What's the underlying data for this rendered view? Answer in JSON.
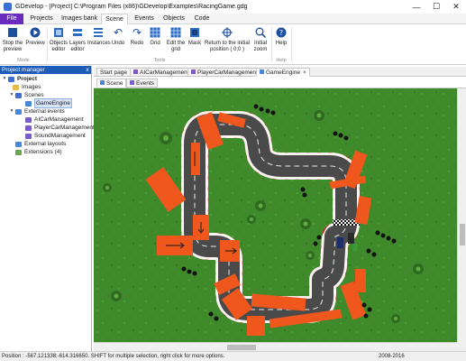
{
  "window": {
    "title": "GDevelop - [Project] C:\\Program Files (x86)\\GDevelop\\Examples\\RacingGame.gdg",
    "minimize": "—",
    "maximize": "☐",
    "close": "✕"
  },
  "menu_tabs": [
    "File",
    "Projects",
    "Images bank",
    "Scene",
    "Events",
    "Objects",
    "Code"
  ],
  "ribbon": {
    "stop_preview": "Stop the preview",
    "preview": "Preview",
    "objects_editor": "Objects editor",
    "layers_editor": "Layers editor",
    "instances": "Instances",
    "undo": "Undo",
    "redo": "Redo",
    "grid": "Grid",
    "edit_grid": "Edit the grid",
    "mask": "Mask",
    "return_initial": "Return to the initial position ( 0;0 )",
    "initial_zoom": "Initial zoom",
    "help": "Help",
    "group_mode": "Mode",
    "group_tools": "Tools",
    "group_help": "Help"
  },
  "project_manager": {
    "title": "Project manager",
    "close": "x",
    "items": {
      "project": "Project",
      "images": "Images",
      "scenes": "Scenes",
      "game_engine": "GameEngine",
      "external_events": "External events",
      "ai_car": "AICarManagement",
      "player_car": "PlayerCarManagement",
      "sound": "SoundManagement",
      "external_layouts": "External layouts",
      "extensions": "Extensions (4)"
    }
  },
  "editor_tabs": {
    "start_page": "Start page",
    "ai_car": "AICarManagement",
    "player_car": "PlayerCarManagement",
    "game_engine": "GameEngine",
    "close": "×"
  },
  "sub_tabs": {
    "scene": "Scene",
    "events": "Events"
  },
  "status": {
    "position": "Position : -567.121338;-614.316650. SHIFT for multiple selection, right click for more options.",
    "years": "2008-2016"
  },
  "colors": {
    "grass": "#3f8a2a",
    "road": "#4a4a4a",
    "curb_red": "#d42a1a",
    "curb_white": "#ffffff",
    "barrier": "#f0571c",
    "file_tab": "#6a2bbf",
    "selection": "#1d5bb8"
  }
}
